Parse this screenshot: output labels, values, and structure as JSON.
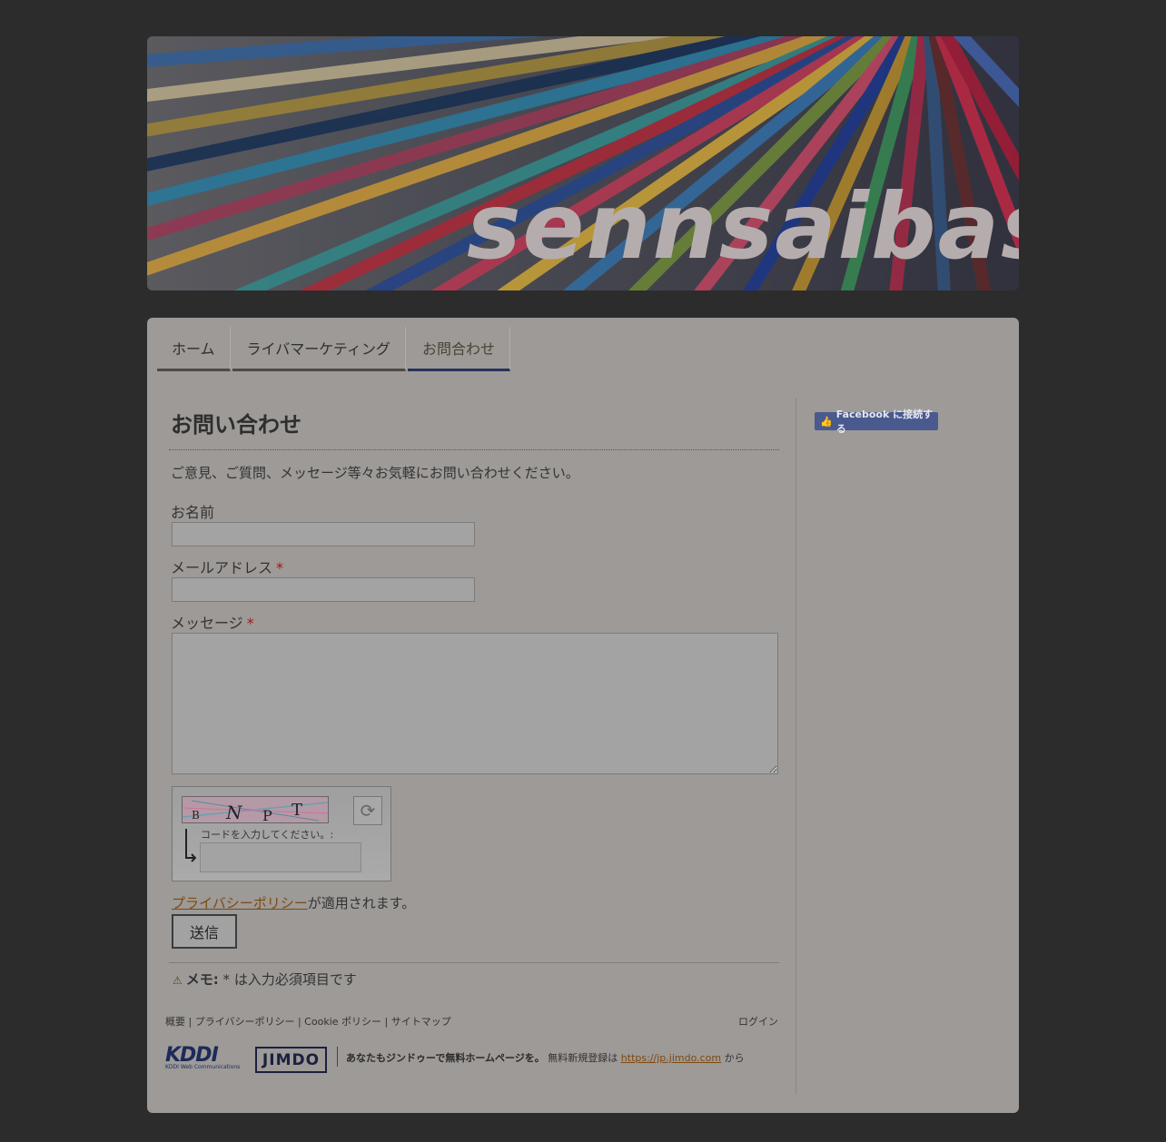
{
  "banner": {
    "title": "sennsaibasi"
  },
  "nav": {
    "items": [
      {
        "label": "ホーム"
      },
      {
        "label": "ライバマーケティング"
      },
      {
        "label": "お問合わせ"
      }
    ],
    "active_index": 2
  },
  "page": {
    "title": "お問い合わせ",
    "intro": "ご意見、ご質問、メッセージ等々お気軽にお問い合わせください。"
  },
  "form": {
    "name_label": "お名前",
    "email_label": "メールアドレス",
    "message_label": "メッセージ",
    "required_mark": "*",
    "captcha": {
      "code": "BNPT",
      "label": "コードを入力してください。:"
    },
    "privacy_link": "プライバシーポリシー",
    "privacy_suffix": "が適用されます。",
    "submit_label": "送信",
    "memo_warn": "⚠",
    "memo_bold": "メモ:",
    "memo_text": "* は入力必須項目です"
  },
  "footer": {
    "links": "概要 | プライバシーポリシー | Cookie ポリシー | サイトマップ",
    "login": "ログイン",
    "kddi_logo": "KDDI",
    "kddi_sub": "KDDI Web Communications",
    "jimdo_logo": "JIMDO",
    "promo_bold": "あなたもジンドゥーで無料ホームページを。",
    "promo_text": " 無料新規登録は ",
    "promo_link": "https://jp.jimdo.com",
    "promo_suffix": " から"
  },
  "sidebar": {
    "facebook_label": "Facebook に接続する"
  },
  "colors": {
    "background": "#2c2c2c",
    "panel": "#9d9a97",
    "active_tab_border": "#28335a",
    "link": "#7c4a10",
    "facebook": "#4a5a8e"
  }
}
